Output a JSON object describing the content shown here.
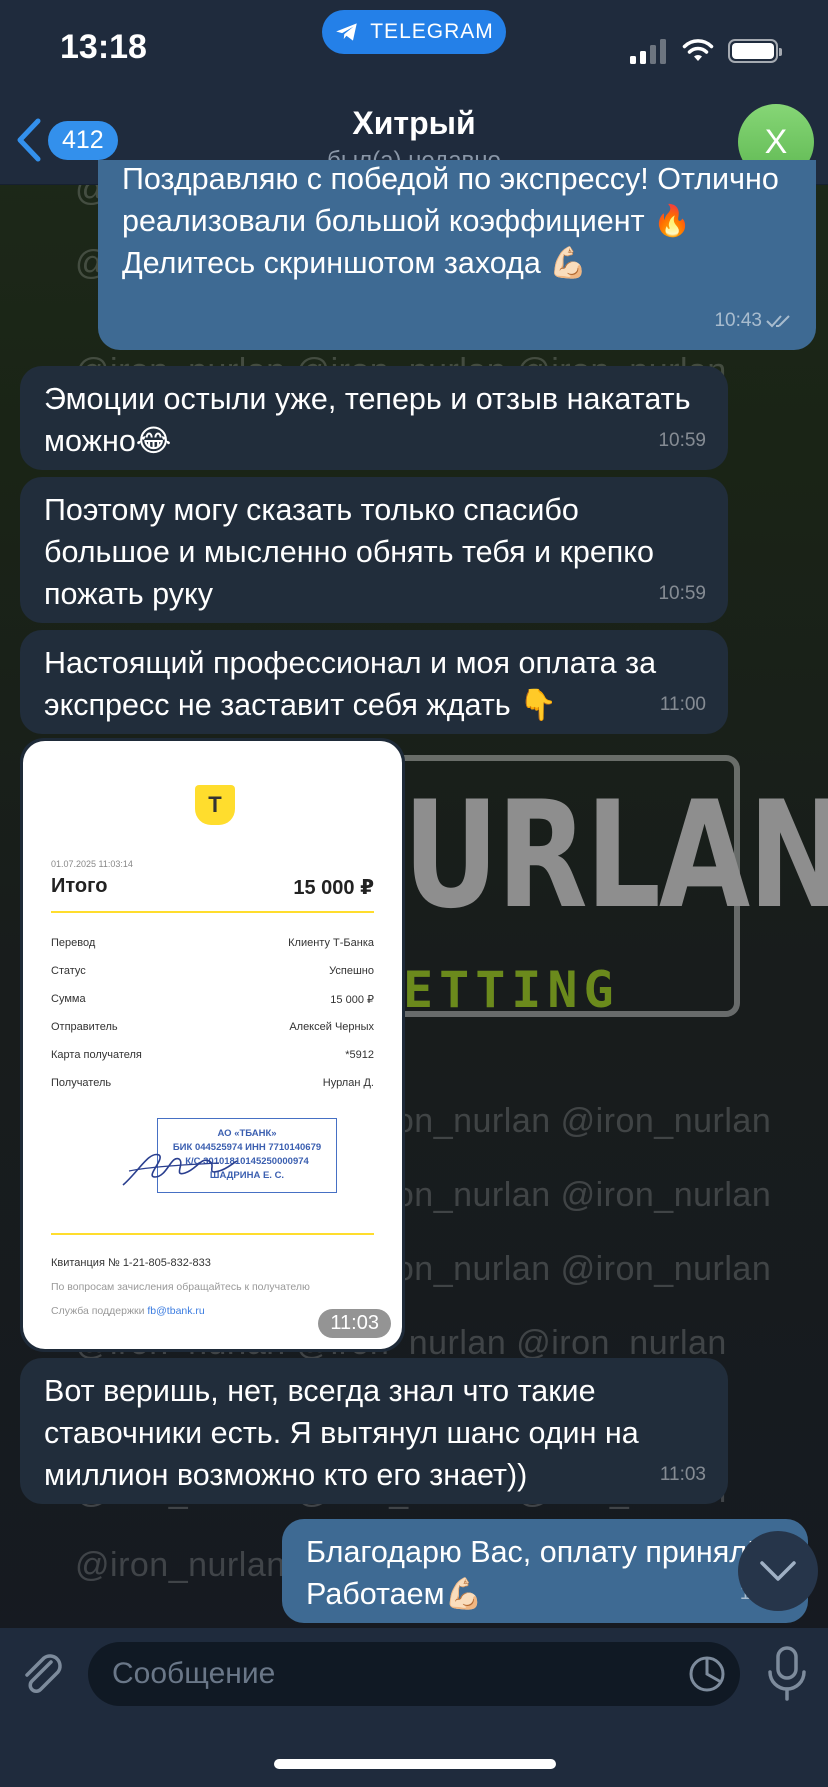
{
  "status_bar": {
    "time": "13:18",
    "pill_label": "TELEGRAM"
  },
  "header": {
    "back_count": "412",
    "title": "Хитрый",
    "subtitle": "был(а) недавно",
    "avatar_letter": "Х"
  },
  "wallpaper": {
    "watermark": "@iron_nurlan",
    "logo_word": "URLAN",
    "logo_sub": "ETTING"
  },
  "messages": [
    {
      "dir": "out",
      "text": "Поздравляю с победой по экспрессу! Отлично реализовали большой коэффициент 🔥 Делитесь скриншотом захода 💪🏻",
      "time": "10:43"
    },
    {
      "dir": "in",
      "text": "Эмоции остыли уже, теперь и отзыв накатать можно😂",
      "time": "10:59"
    },
    {
      "dir": "in",
      "text": "Поэтому могу сказать только спасибо большое и мысленно обнять тебя и крепко пожать руку",
      "time": "10:59"
    },
    {
      "dir": "in",
      "text": "Настоящий профессионал и моя оплата за экспресс не заставит себя ждать 👇",
      "time": "11:00"
    },
    {
      "dir": "in",
      "text": "Вот веришь, нет, всегда знал что такие ставочники есть. Я вытянул шанс один на миллион возможно кто его знает))",
      "time": "11:03"
    },
    {
      "dir": "out",
      "text": "Благодарю Вас, оплату принял! Работаем💪🏻",
      "time": "11:05"
    }
  ],
  "receipt": {
    "logo_letter": "Т",
    "date": "01.07.2025  11:03:14",
    "total_label": "Итого",
    "total_value": "15 000 ₽",
    "rows": [
      {
        "label": "Перевод",
        "value": "Клиенту Т-Банка"
      },
      {
        "label": "Статус",
        "value": "Успешно"
      },
      {
        "label": "Сумма",
        "value": "15 000 ₽"
      },
      {
        "label": "Отправитель",
        "value": "Алексей Черных"
      },
      {
        "label": "Карта получателя",
        "value": "*5912"
      },
      {
        "label": "Получатель",
        "value": "Нурлан Д."
      }
    ],
    "stamp_lines": [
      "АО «ТБАНК»",
      "БИК 044525974 ИНН 7710140679",
      "К/С 30101810145250000974",
      "ШАДРИНА Е. С."
    ],
    "receipt_no": "Квитанция  № 1-21-805-832-833",
    "note": "По вопросам зачисления обращайтесь к получателю",
    "support_label": "Служба поддержки",
    "support_email": "fb@tbank.ru",
    "time": "11:03"
  },
  "input": {
    "placeholder": "Сообщение"
  },
  "colors": {
    "accent": "#3390ec",
    "out_bubble": "#3e6a93",
    "in_bubble": "#212d3b",
    "header": "#1f2b3d",
    "avatar": "#74c866",
    "brand_yellow": "#ffdd2d"
  }
}
